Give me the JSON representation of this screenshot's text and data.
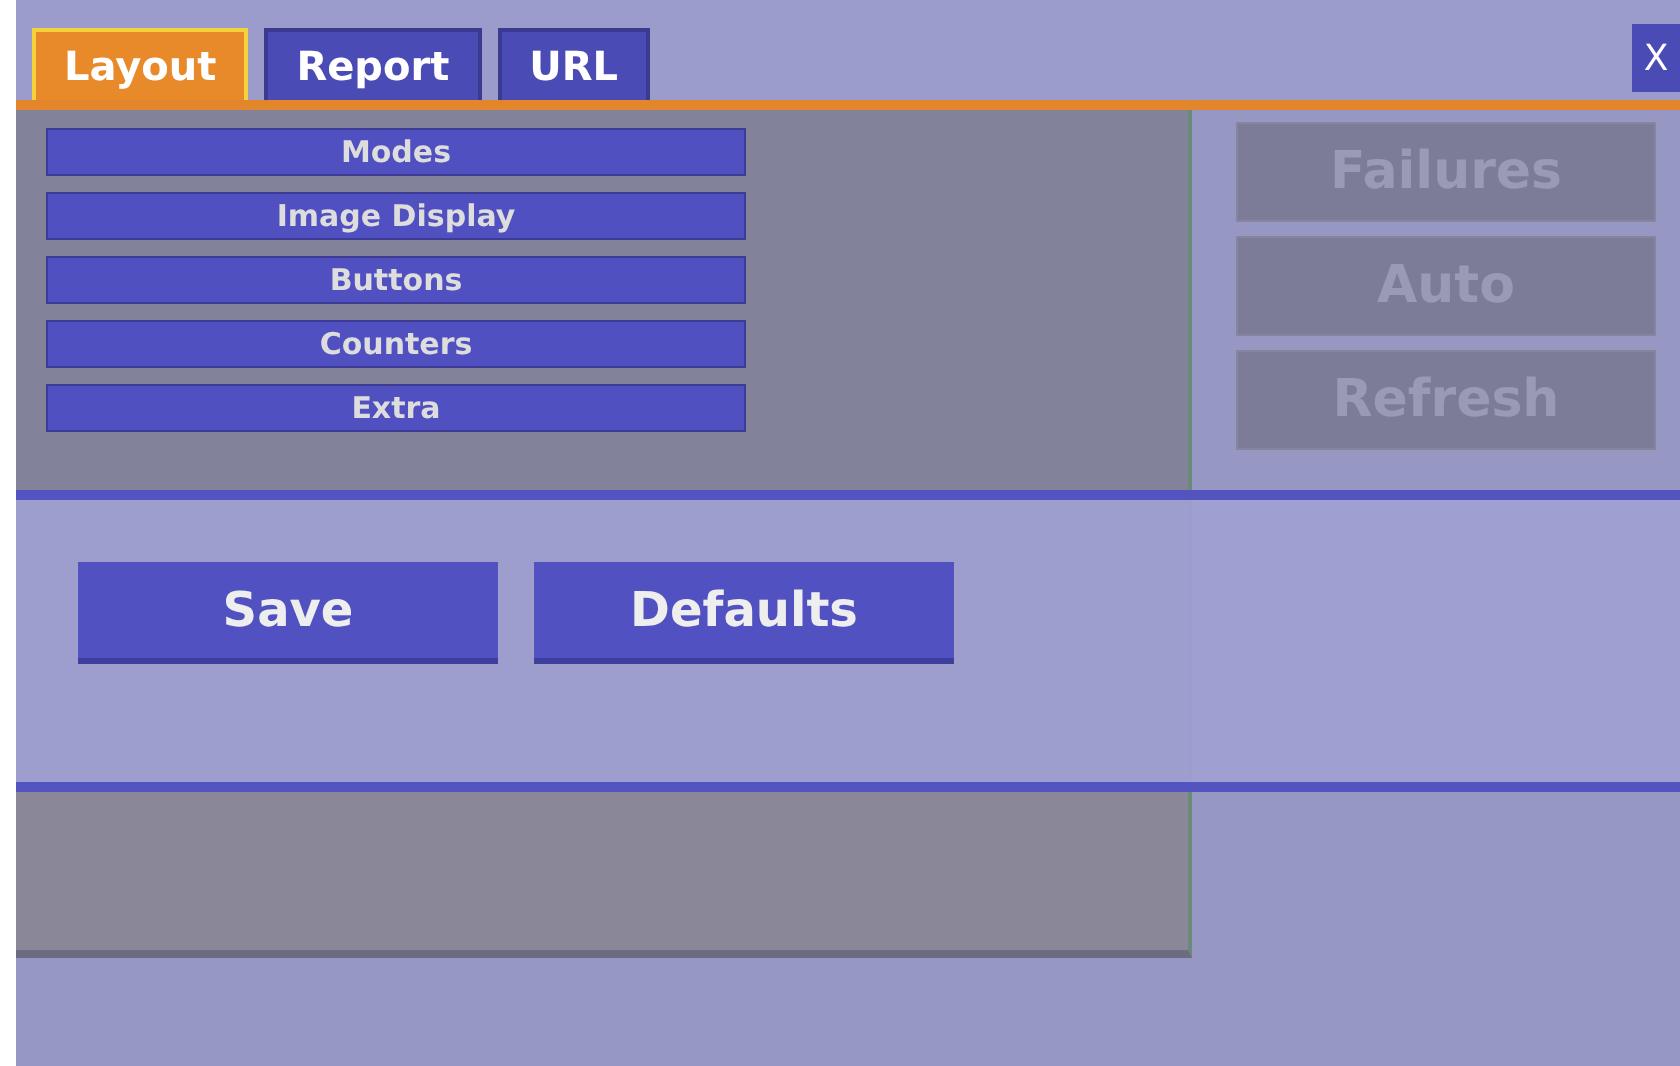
{
  "tabs": [
    {
      "label": "Layout",
      "selected": true
    },
    {
      "label": "Report",
      "selected": false
    },
    {
      "label": "URL",
      "selected": false
    }
  ],
  "close_button": "X",
  "menu_items": [
    "Modes",
    "Image Display",
    "Buttons",
    "Counters",
    "Extra"
  ],
  "background_buttons": [
    "Failures",
    "Auto",
    "Refresh"
  ],
  "buttons": [
    "Save",
    "Defaults"
  ]
}
